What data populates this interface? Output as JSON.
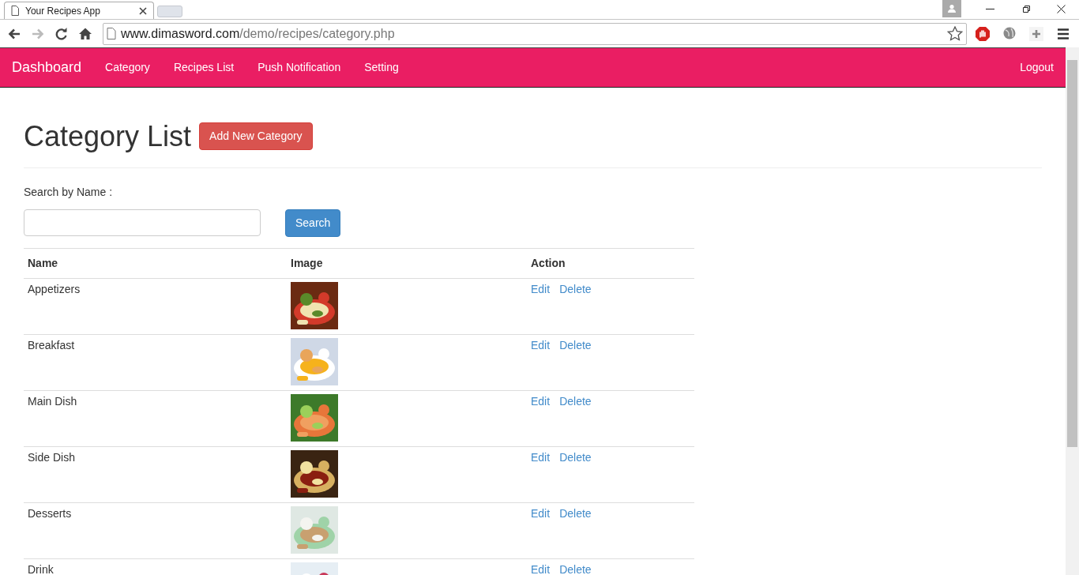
{
  "browser": {
    "tab_title": "Your Recipes App",
    "url_host": "www.dimasword.com",
    "url_path": "/demo/recipes/category.php"
  },
  "navbar": {
    "brand": "Dashboard",
    "items": [
      "Category",
      "Recipes List",
      "Push Notification",
      "Setting"
    ],
    "logout": "Logout"
  },
  "page": {
    "title": "Category List",
    "add_button": "Add New Category",
    "search_label": "Search by Name :",
    "search_button": "Search"
  },
  "table": {
    "columns": [
      "Name",
      "Image",
      "Action"
    ],
    "rows": [
      {
        "name": "Appetizers",
        "image": {
          "kind": "picture"
        },
        "actions": [
          "Edit",
          "Delete"
        ]
      },
      {
        "name": "Breakfast",
        "image": {
          "kind": "picture"
        },
        "actions": [
          "Edit",
          "Delete"
        ]
      },
      {
        "name": "Main Dish",
        "image": {
          "kind": "picture"
        },
        "actions": [
          "Edit",
          "Delete"
        ]
      },
      {
        "name": "Side Dish",
        "image": {
          "kind": "picture"
        },
        "actions": [
          "Edit",
          "Delete"
        ]
      },
      {
        "name": "Desserts",
        "image": {
          "kind": "picture"
        },
        "actions": [
          "Edit",
          "Delete"
        ]
      },
      {
        "name": "Drink",
        "image": {
          "kind": "picture"
        },
        "actions": [
          "Edit",
          "Delete"
        ]
      }
    ]
  }
}
